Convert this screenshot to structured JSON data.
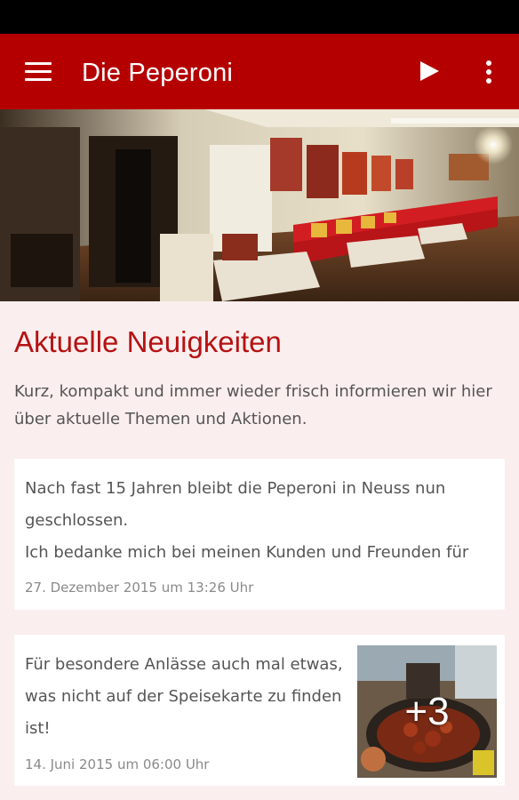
{
  "app": {
    "title": "Die Peperoni",
    "icons": {
      "menu": "menu-icon",
      "play": "play-icon",
      "more": "more-vert-icon"
    },
    "colors": {
      "toolbar": "#b50000",
      "accent": "#b51212",
      "background": "#fbeeee"
    }
  },
  "hero": {
    "image": "restaurant-interior-panorama"
  },
  "news": {
    "title": "Aktuelle Neuigkeiten",
    "intro": "Kurz, kompakt und immer wieder frisch informieren wir hier über aktuelle Themen und Aktionen.",
    "items": [
      {
        "lines": [
          "Nach fast 15 Jahren bleibt die Peperoni in Neuss nun",
          "geschlossen.",
          "Ich bedanke mich bei meinen Kunden und Freunden für"
        ],
        "date": "27. Dezember 2015 um 13:26 Uhr"
      },
      {
        "text": "Für besondere Anlässe auch mal etwas, was nicht auf der Speisekarte zu finden ist!",
        "date": "14. Juni 2015 um 06:00 Uhr",
        "thumb_count": "+3"
      }
    ]
  }
}
